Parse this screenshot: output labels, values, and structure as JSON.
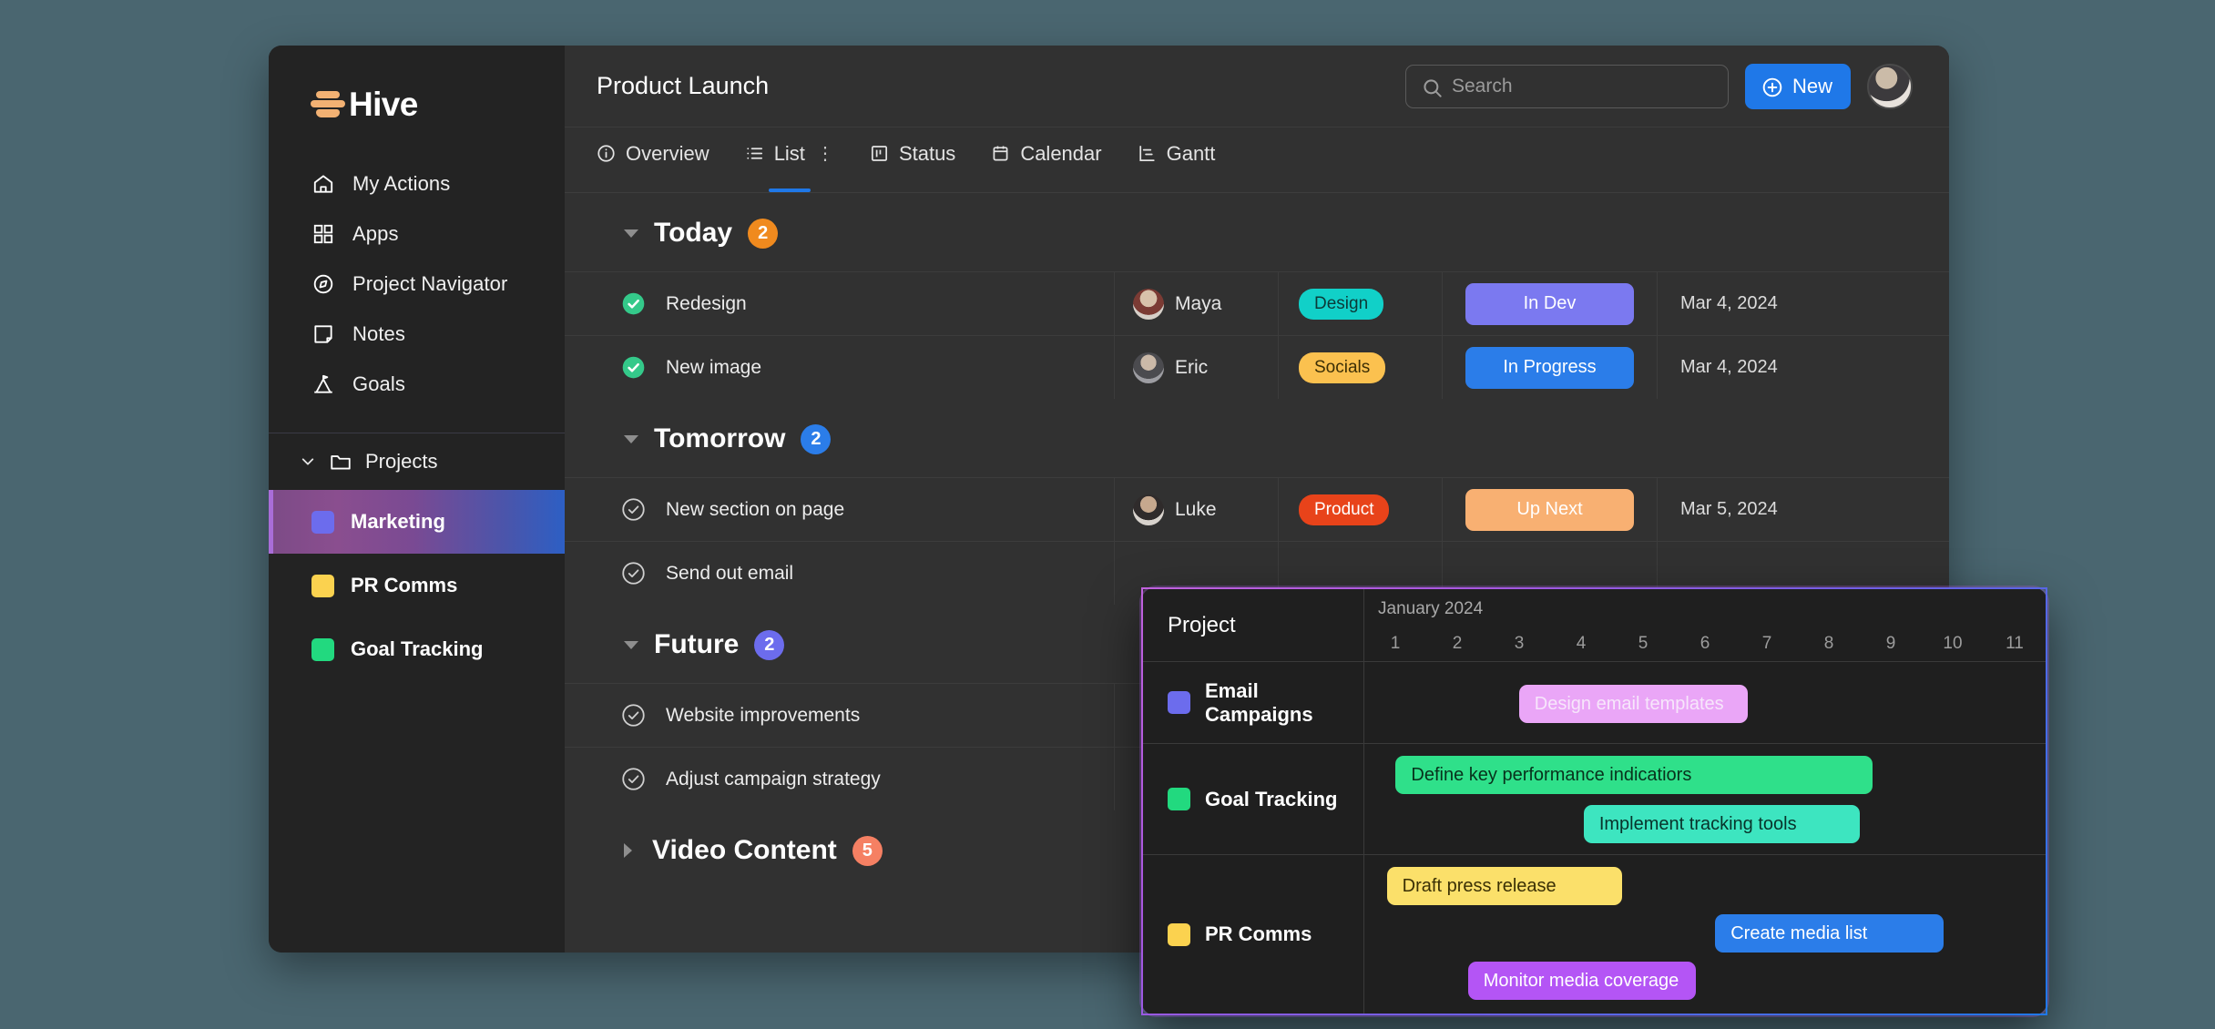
{
  "brand": {
    "name": "Hive",
    "logo_icon": "hive-logo-icon"
  },
  "sidebar": {
    "nav": [
      {
        "label": "My Actions",
        "icon": "home-icon"
      },
      {
        "label": "Apps",
        "icon": "grid-icon"
      },
      {
        "label": "Project Navigator",
        "icon": "compass-icon"
      },
      {
        "label": "Notes",
        "icon": "note-icon"
      },
      {
        "label": "Goals",
        "icon": "mountain-flag-icon"
      }
    ],
    "projects_header": {
      "label": "Projects",
      "icon": "folder-icon",
      "chevron": "chevron-down-icon",
      "expanded": true
    },
    "projects": [
      {
        "label": "Marketing",
        "color": "#6c6ced",
        "active": true
      },
      {
        "label": "PR Comms",
        "color": "#fbd24f",
        "active": false
      },
      {
        "label": "Goal Tracking",
        "color": "#22d97f",
        "active": false
      }
    ]
  },
  "header": {
    "title": "Product Launch",
    "search": {
      "placeholder": "Search",
      "value": "",
      "icon": "search-icon"
    },
    "new_button": {
      "label": "New",
      "icon": "plus-circle-icon",
      "color": "#1f78e8"
    },
    "avatar": "user-avatar"
  },
  "tabs": [
    {
      "label": "Overview",
      "icon": "info-circle-icon",
      "active": false
    },
    {
      "label": "List",
      "icon": "list-icon",
      "active": true,
      "menu": "⋮"
    },
    {
      "label": "Status",
      "icon": "status-board-icon",
      "active": false
    },
    {
      "label": "Calendar",
      "icon": "calendar-icon",
      "active": false
    },
    {
      "label": "Gantt",
      "icon": "gantt-icon",
      "active": false
    }
  ],
  "groups": [
    {
      "title": "Today",
      "count": "2",
      "badge_color": "#f08a1e",
      "expanded": true,
      "rows": [
        {
          "task": "Redesign",
          "done": true,
          "assignee": "Maya",
          "avatar": "maya",
          "tag": "Design",
          "tag_color": "#11d0c8",
          "tag_text": "#0c3a38",
          "status": "In Dev",
          "status_color": "#7b79f0",
          "status_text": "#ffffff",
          "date": "Mar 4, 2024"
        },
        {
          "task": "New image",
          "done": true,
          "assignee": "Eric",
          "avatar": "eric",
          "tag": "Socials",
          "tag_color": "#fbc14f",
          "tag_text": "#3c2f06",
          "status": "In Progress",
          "status_color": "#2b7de9",
          "status_text": "#ffffff",
          "date": "Mar 4, 2024"
        }
      ]
    },
    {
      "title": "Tomorrow",
      "count": "2",
      "badge_color": "#2b7de9",
      "expanded": true,
      "rows": [
        {
          "task": "New section on page",
          "done": false,
          "assignee": "Luke",
          "avatar": "luke",
          "tag": "Product",
          "tag_color": "#e8431a",
          "tag_text": "#ffffff",
          "status": "Up Next",
          "status_color": "#f8b072",
          "status_text": "#ffffff",
          "date": "Mar 5, 2024"
        },
        {
          "task": "Send out email",
          "done": false,
          "assignee": "",
          "avatar": "",
          "tag": "",
          "tag_color": "",
          "tag_text": "",
          "status": "",
          "status_color": "",
          "status_text": "",
          "date": ""
        }
      ]
    },
    {
      "title": "Future",
      "count": "2",
      "badge_color": "#6c6ced",
      "expanded": true,
      "rows": [
        {
          "task": "Website improvements",
          "done": false,
          "assignee": "",
          "avatar": "",
          "tag": "",
          "tag_color": "",
          "tag_text": "",
          "status": "",
          "status_color": "",
          "status_text": "",
          "date": ""
        },
        {
          "task": "Adjust campaign strategy",
          "done": false,
          "assignee": "",
          "avatar": "",
          "tag": "",
          "tag_color": "",
          "tag_text": "",
          "status": "",
          "status_color": "",
          "status_text": "",
          "date": ""
        }
      ]
    },
    {
      "title": "Video Content",
      "count": "5",
      "badge_color": "#f58063",
      "expanded": false,
      "rows": []
    }
  ],
  "gantt": {
    "project_column_label": "Project",
    "month": "January 2024",
    "days": [
      "1",
      "2",
      "3",
      "4",
      "5",
      "6",
      "7",
      "8",
      "9",
      "10",
      "11"
    ],
    "rows": [
      {
        "project": "Email Campaigns",
        "color": "#6c6ced",
        "bars": [
          {
            "label": "Design email templates",
            "color": "#eaa6f7",
            "text_color": "#f7e6fb",
            "start_day": 3.5,
            "end_day": 7.2,
            "lane": 0
          }
        ]
      },
      {
        "project": "Goal Tracking",
        "color": "#22d97f",
        "bars": [
          {
            "label": "Define key performance indicatiors",
            "color": "#2fe08a",
            "text_color": "#08321c",
            "start_day": 1.55,
            "end_day": 9.2,
            "lane": 0
          },
          {
            "label": "Implement tracking tools",
            "color": "#3de5c0",
            "text_color": "#08332b",
            "start_day": 4.6,
            "end_day": 9.0,
            "lane": 1
          }
        ]
      },
      {
        "project": "PR Comms",
        "color": "#fbd24f",
        "bars": [
          {
            "label": "Draft press release",
            "color": "#fbe06a",
            "text_color": "#3a3005",
            "start_day": 1.35,
            "end_day": 5.1,
            "lane": 0
          },
          {
            "label": "Create media list",
            "color": "#2b7de9",
            "text_color": "#ffffff",
            "start_day": 6.6,
            "end_day": 10.2,
            "lane": 1
          },
          {
            "label": "Monitor media coverage",
            "color": "#b455f5",
            "text_color": "#ffffff",
            "start_day": 2.6,
            "end_day": 6.2,
            "lane": 2
          }
        ]
      }
    ]
  }
}
